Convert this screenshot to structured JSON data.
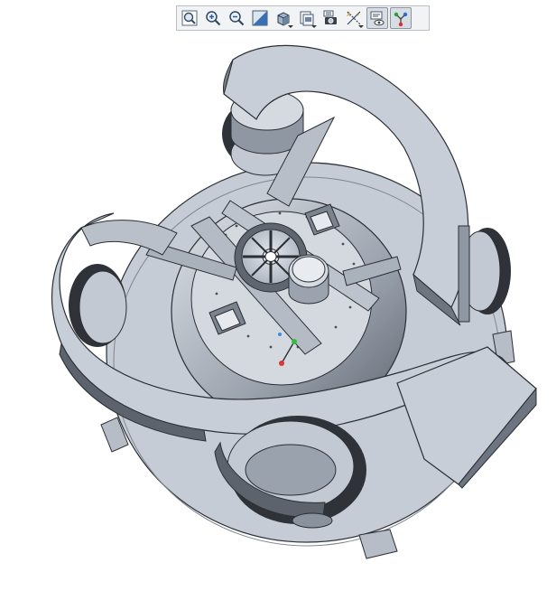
{
  "toolbar": {
    "buttons": [
      {
        "id": "refit",
        "icon": "refit-icon"
      },
      {
        "id": "zoom-in",
        "icon": "zoom-in-icon"
      },
      {
        "id": "zoom-out",
        "icon": "zoom-out-icon"
      },
      {
        "id": "repaint",
        "icon": "repaint-icon"
      },
      {
        "id": "display-style",
        "icon": "shaded-cube-icon",
        "dropdown": true
      },
      {
        "id": "saved-views",
        "icon": "saved-views-icon",
        "dropdown": true
      },
      {
        "id": "view-manager",
        "icon": "view-manager-icon"
      },
      {
        "id": "datum-display",
        "icon": "datum-display-icon",
        "dropdown": true
      },
      {
        "id": "annotation-display",
        "icon": "annotation-display-icon",
        "active": true
      },
      {
        "id": "spin-center",
        "icon": "spin-center-icon",
        "active": true
      }
    ]
  },
  "viewport": {
    "model_color": "#c8ced7",
    "edge_color": "#2b2f35",
    "shadow_color": "#5a6068",
    "background": "#ffffff"
  }
}
